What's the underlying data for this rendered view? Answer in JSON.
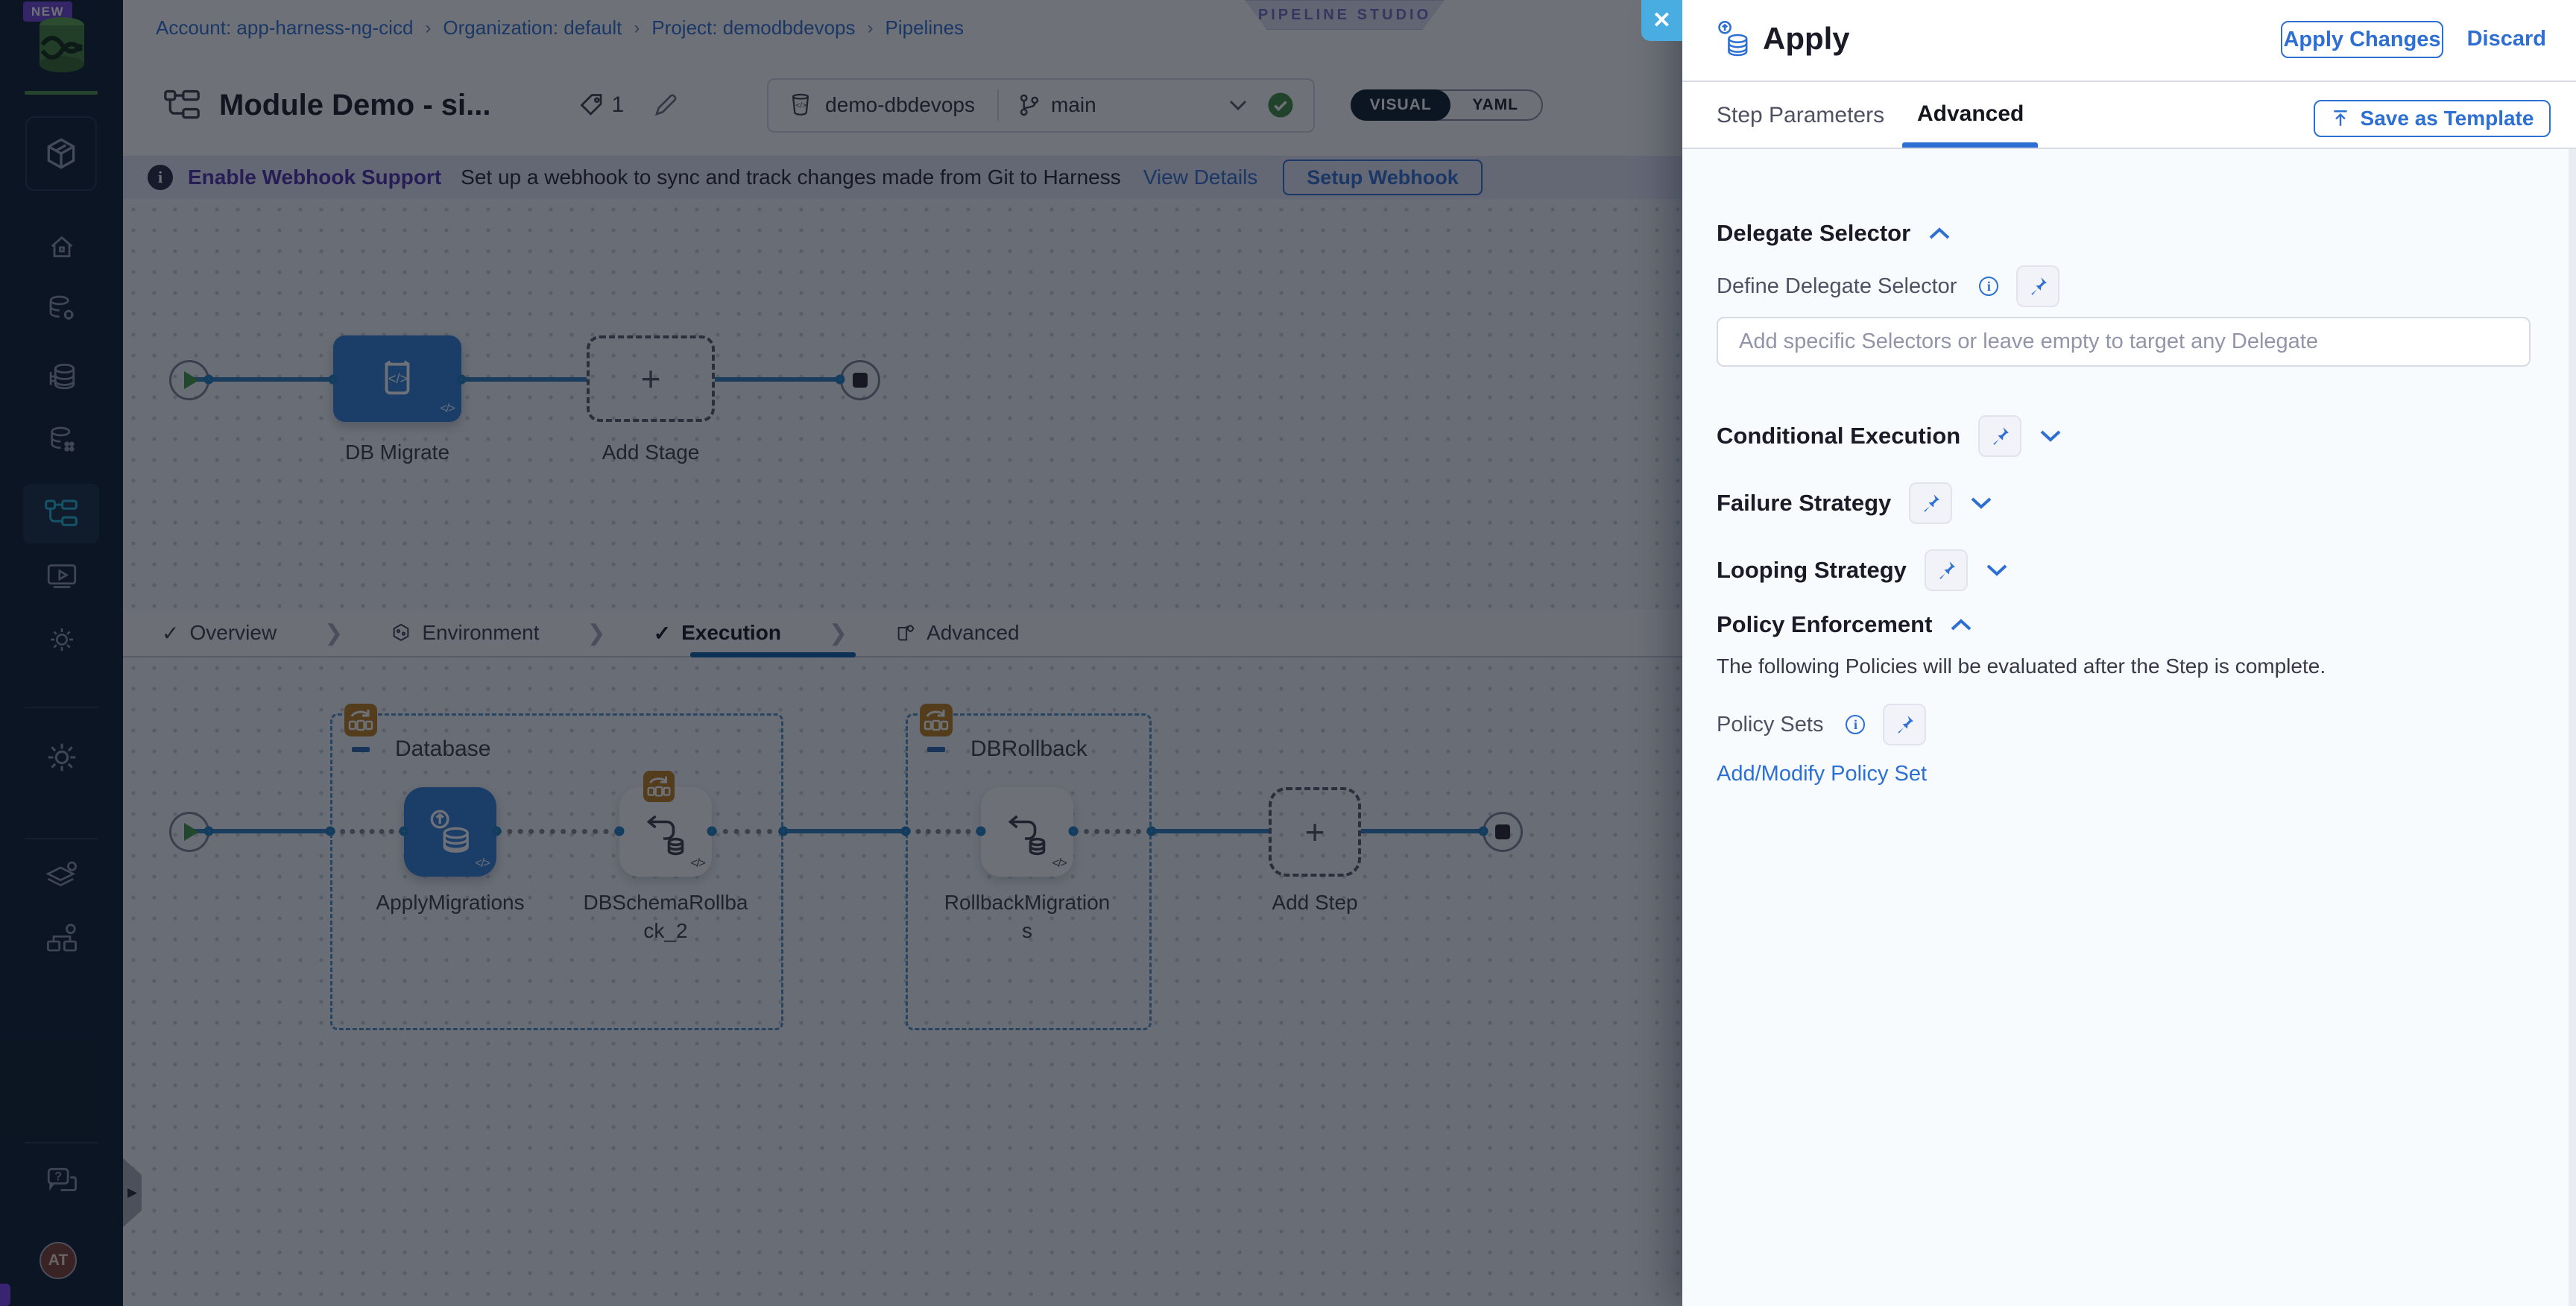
{
  "sidebar": {
    "new_badge": "NEW",
    "avatar_initials": "AT"
  },
  "breadcrumb": {
    "items": [
      "Account: app-harness-ng-cicd",
      "Organization: default",
      "Project: demodbdevops",
      "Pipelines"
    ]
  },
  "studio_badge": "PIPELINE STUDIO",
  "header": {
    "title": "Module Demo - si...",
    "tag_count": "1",
    "repo": "demo-dbdevops",
    "branch": "main",
    "view_toggle": {
      "visual": "VISUAL",
      "yaml": "YAML",
      "selected": "VISUAL"
    }
  },
  "webhook_banner": {
    "title": "Enable Webhook Support",
    "message": "Set up a webhook to sync and track changes made from Git to Harness",
    "link": "View Details",
    "button": "Setup Webhook"
  },
  "stage_graph": {
    "stage_label": "DB Migrate",
    "add_stage_label": "Add Stage"
  },
  "tabs": {
    "items": [
      "Overview",
      "Environment",
      "Execution",
      "Advanced"
    ],
    "selected": "Execution"
  },
  "execution_graph": {
    "groups": [
      {
        "name": "Database",
        "steps": [
          "ApplyMigrations",
          "DBSchemaRollback_2"
        ]
      },
      {
        "name": "DBRollback",
        "steps": [
          "RollbackMigrations"
        ]
      }
    ],
    "add_step_label": "Add Step"
  },
  "drawer": {
    "title": "Apply",
    "apply_changes": "Apply Changes",
    "discard": "Discard",
    "tabs": [
      "Step Parameters",
      "Advanced"
    ],
    "selected_tab": "Advanced",
    "save_as_template": "Save as Template",
    "close_label": "✕",
    "delegate": {
      "heading": "Delegate Selector",
      "label": "Define Delegate Selector",
      "placeholder": "Add specific Selectors or leave empty to target any Delegate"
    },
    "sections": [
      "Conditional Execution",
      "Failure Strategy",
      "Looping Strategy"
    ],
    "policy": {
      "heading": "Policy Enforcement",
      "description": "The following Policies will be evaluated after the Step is complete.",
      "label": "Policy Sets",
      "link": "Add/Modify Policy Set"
    }
  },
  "colors": {
    "primary_blue": "#2e6fd3",
    "node_blue": "#2e7fd9",
    "success_green": "#3f9a44",
    "logo_green": "#4d9a43",
    "group_orange": "#bf7d1e",
    "close_button_blue": "#49ade2",
    "nav_selected_teal": "#1fb3d9",
    "avatar_red": "#7c3c30"
  }
}
